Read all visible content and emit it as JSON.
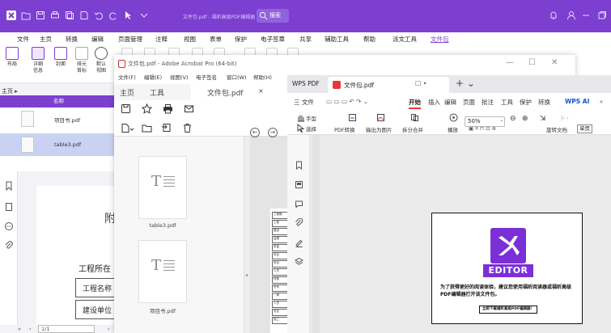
{
  "editor": {
    "title_bar": {
      "doc_title": "文件包.pdf - 福昕高级PDF编辑器",
      "search_label": "搜索"
    },
    "menu": [
      "文件",
      "主页",
      "转换",
      "编辑",
      "页面管理",
      "注释",
      "视图",
      "表单",
      "保护",
      "电子签章",
      "共享",
      "辅助工具",
      "帮助",
      "派文工具",
      "文件包"
    ],
    "menu_active_index": 14,
    "ribbon": [
      {
        "label": "布局",
        "icon": "layout-icon"
      },
      {
        "label": "详细\n信息",
        "icon": "details-icon"
      },
      {
        "label": "封面",
        "icon": "cover-icon"
      },
      {
        "label": "排元\n首标",
        "icon": "sort-icon"
      },
      {
        "label": "默认\n视图",
        "icon": "default-view-icon"
      }
    ],
    "panel_label": "主页 ▸",
    "file_list_header": "名称",
    "files": [
      "项目书.pdf",
      "table3.pdf"
    ],
    "selected_file_index": 1,
    "page": {
      "big_char": "附",
      "heading": "工程所在",
      "cell1": "工程名称",
      "cell2": "建设单位"
    },
    "pager": {
      "current": "1/1"
    }
  },
  "acrobat": {
    "title": "文件包.pdf - Adobe Acrobat Pro (64-bit)",
    "menu": [
      "文件(F)",
      "编辑(E)",
      "视图(V)",
      "电子签名",
      "窗口(W)",
      "帮助(H)"
    ],
    "tabs": [
      "主页",
      "工具",
      "文件包.pdf"
    ],
    "attachments": [
      "table3.pdf",
      "项目书.pdf"
    ],
    "mini_page": [
      "工程概",
      "工程",
      "建设",
      "监理",
      "质量",
      "安全",
      "安全",
      "人员",
      "特殊",
      "所有",
      "一周",
      "人员",
      "安全",
      "施工"
    ]
  },
  "wps": {
    "app_tab": "WPS PDF",
    "doc_tab": "文件包.pdf",
    "menu": [
      "三 文件",
      "开始",
      "插入",
      "编辑",
      "页面",
      "批注",
      "工具",
      "保护",
      "转换",
      "WPS AI"
    ],
    "menu_active": "开始",
    "toolbar": {
      "hand": "手型",
      "select": "选择",
      "pdf_convert": "PDF转换",
      "export_image": "输出为图片",
      "split_merge": "拆分合并",
      "play": "播放",
      "rotate": "旋转文档",
      "single": "单页",
      "zoom": "50%"
    },
    "dialog": {
      "logo_text": "EDITOR",
      "message": "为了获得更好的阅读体验，建议您使用福昕阅读器或福昕高级PDF编辑器打开该文件包。",
      "download": "立即下载福昕高级PDF编辑器！"
    }
  },
  "colors": {
    "foxit_purple": "#7c3fd0",
    "wps_red": "#e53935",
    "editor_logo": "#7b2fd6"
  }
}
